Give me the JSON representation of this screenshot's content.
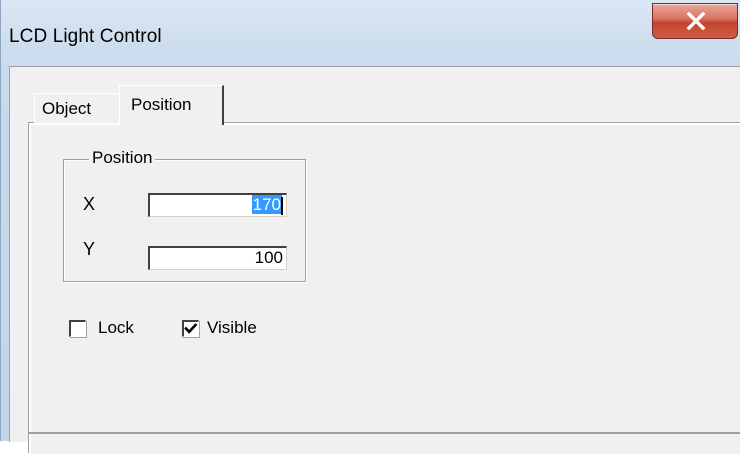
{
  "window": {
    "title": "LCD Light Control",
    "close_icon": "close-icon",
    "close_color": "#c9432f"
  },
  "tabs": [
    {
      "label": "Object",
      "selected": false
    },
    {
      "label": "Position",
      "selected": true
    }
  ],
  "position_group": {
    "legend": "Position",
    "x_label": "X",
    "x_value_selected": "170",
    "y_label": "Y",
    "y_value": "100"
  },
  "options": {
    "lock_label": "Lock",
    "lock_checked": false,
    "visible_label": "Visible",
    "visible_checked": true,
    "check_icon": "checkmark-icon"
  },
  "colors": {
    "selection": "#3399ff",
    "dialog_face": "#f0f0f0"
  }
}
